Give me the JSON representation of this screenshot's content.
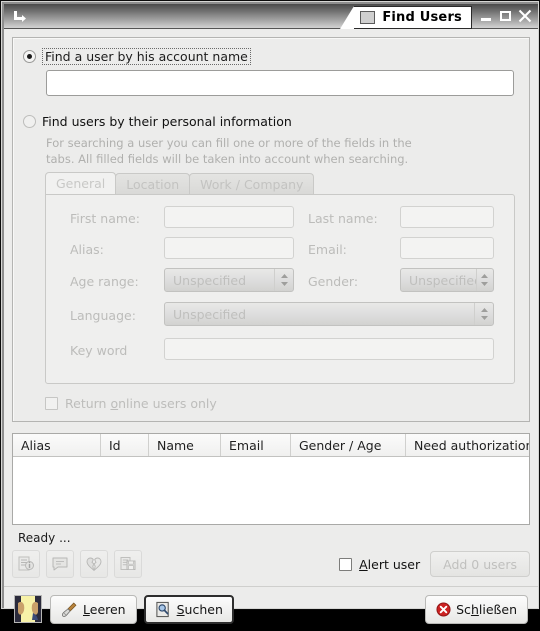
{
  "window": {
    "title": "Find Users",
    "shade_icon": "shade-arrow-icon",
    "window_icon": "window-icon",
    "minimize_label": "Minimize",
    "maximize_label": "Maximize",
    "close_label": "Close"
  },
  "search_mode": {
    "by_account": {
      "label": "Find a user by his account name",
      "selected": true,
      "input_value": "",
      "input_placeholder": ""
    },
    "by_personal": {
      "label": "Find users by their personal information",
      "selected": false,
      "hint_line1": "For searching a user you can fill one or more of the fields in the",
      "hint_line2": "tabs. All filled fields will be taken into account when searching."
    }
  },
  "tabs": [
    {
      "label": "General",
      "active": true
    },
    {
      "label": "Location",
      "active": false
    },
    {
      "label": "Work / Company",
      "active": false
    }
  ],
  "general_tab": {
    "first_name": {
      "label": "First name:",
      "value": ""
    },
    "last_name": {
      "label": "Last name:",
      "value": ""
    },
    "alias": {
      "label": "Alias:",
      "value": ""
    },
    "email": {
      "label": "Email:",
      "value": ""
    },
    "age_range": {
      "label": "Age range:",
      "value": "Unspecified"
    },
    "gender": {
      "label": "Gender:",
      "value": "Unspecified"
    },
    "language": {
      "label": "Language:",
      "value": "Unspecified"
    },
    "key_word": {
      "label": "Key word",
      "value": ""
    }
  },
  "online_only": {
    "label_pre": "Return ",
    "label_mnemonic": "o",
    "label_post": "nline users only",
    "checked": false
  },
  "results": {
    "columns": [
      "Alias",
      "Id",
      "Name",
      "Email",
      "Gender / Age",
      "Need authorization"
    ],
    "rows": []
  },
  "status": {
    "text": "Ready ..."
  },
  "result_toolbar": {
    "buttons": [
      {
        "name": "user-info-icon",
        "label": "User info",
        "enabled": false
      },
      {
        "name": "chat-icon",
        "label": "Chat",
        "enabled": false
      },
      {
        "name": "broken-heart-icon",
        "label": "Remove contact",
        "enabled": false
      },
      {
        "name": "save-contact-icon",
        "label": "Add to contacts",
        "enabled": false
      }
    ],
    "alert_user": {
      "label_pre": "",
      "label_mnemonic": "A",
      "label_post": "lert user",
      "checked": false
    },
    "add_users_button": {
      "label": "Add 0 users",
      "enabled": false
    }
  },
  "action_bar": {
    "avatar_icon": "avatar-thumbnail-icon",
    "clear_button": {
      "label_pre": "",
      "label_mnemonic": "L",
      "label_post": "eeren",
      "icon": "broom-icon"
    },
    "search_button": {
      "label_pre": "",
      "label_mnemonic": "S",
      "label_post": "uchen",
      "icon": "search-document-icon",
      "default": true
    },
    "close_button": {
      "label_pre": "Sc",
      "label_mnemonic": "h",
      "label_post": "ließen",
      "icon": "close-circle-icon"
    }
  },
  "colors": {
    "window_bg": "#ececeb",
    "accent_close": "#cc2222",
    "text": "#1c1c1c",
    "disabled_text": "#bdbdbb"
  }
}
